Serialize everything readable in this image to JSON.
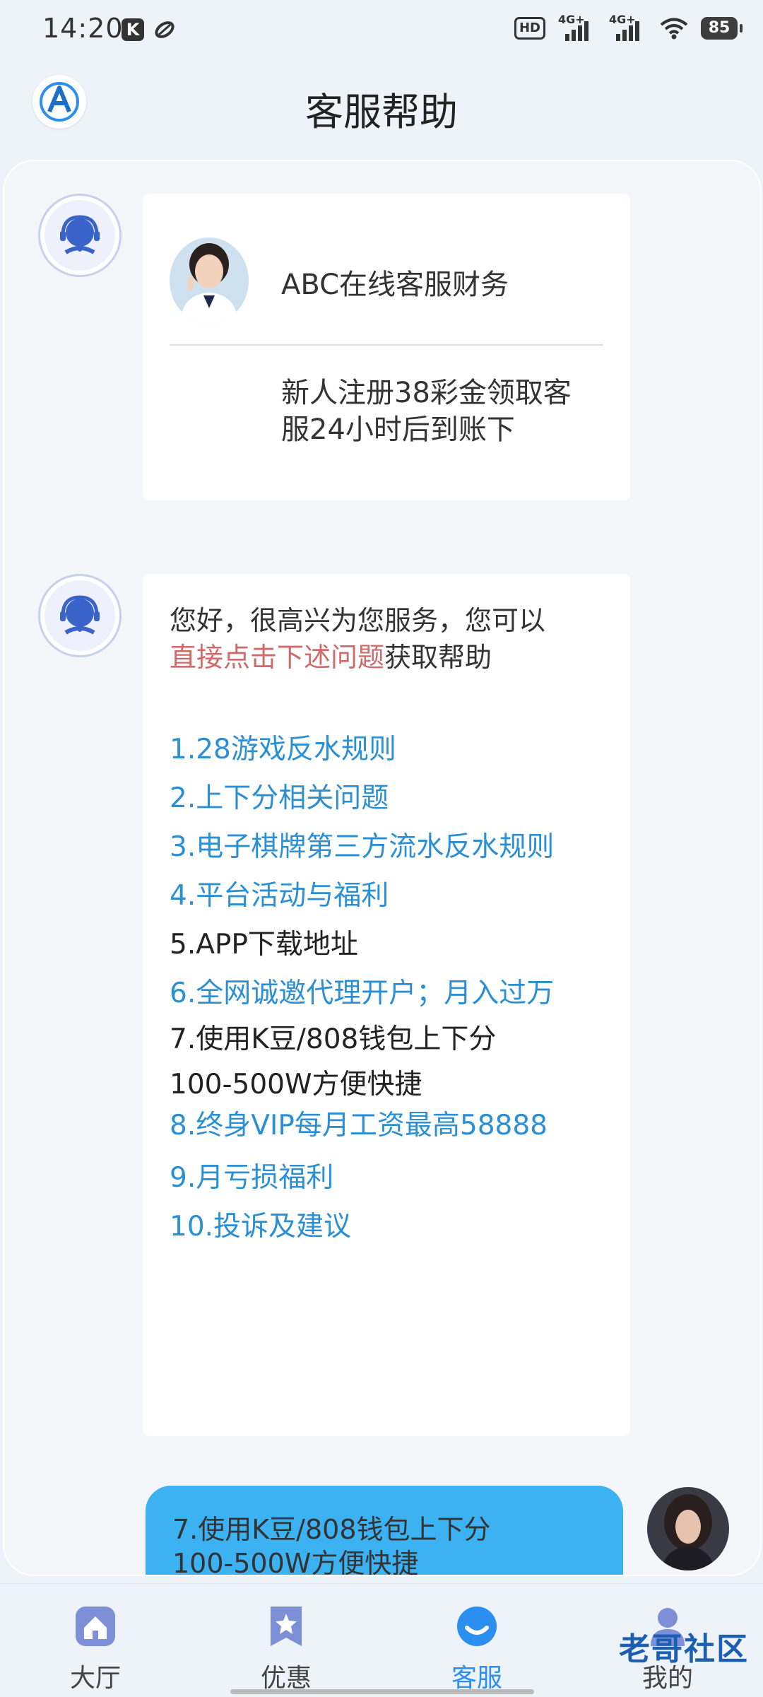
{
  "status_bar": {
    "time": "14:20",
    "k_badge": "K",
    "hd_label": "HD",
    "signal_1": "4G+",
    "signal_2": "4G+",
    "battery": "85"
  },
  "header": {
    "title": "客服帮助",
    "logo_icon": "app-logo-icon"
  },
  "agent_card": {
    "name": "ABC在线客服财务",
    "notice_line_1": "新人注册38彩金领取客",
    "notice_line_2": "服24小时后到账下"
  },
  "welcome": {
    "greeting_line_1": "您好，很高兴为您服务，您可以",
    "greeting_highlight": "直接点击下述问题",
    "greeting_suffix": "获取帮助",
    "highlight_color": "#d06a6a"
  },
  "questions": [
    {
      "text": "1.28游戏反水规则",
      "color": "blue"
    },
    {
      "text": "2.上下分相关问题",
      "color": "blue"
    },
    {
      "text": "3.电子棋牌第三方流水反水规则",
      "color": "blue"
    },
    {
      "text": "4.平台活动与福利",
      "color": "blue"
    },
    {
      "text": "5.APP下载地址",
      "color": "black"
    },
    {
      "text": "6.全网诚邀代理开户；月入过万",
      "color": "blue"
    },
    {
      "text_line_1": "7.使用K豆/808钱包上下分",
      "text_line_2": "100-500W方便快捷",
      "color": "black"
    },
    {
      "text": "8.终身VIP每月工资最高58888",
      "color": "blue"
    },
    {
      "text": "9.月亏损福利",
      "color": "blue"
    },
    {
      "text": "10.投诉及建议",
      "color": "blue"
    }
  ],
  "user_message": {
    "line_1": "7.使用K豆/808钱包上下分",
    "line_2": "100-500W方便快捷",
    "bubble_color": "#3cb2f3"
  },
  "bottom_nav": {
    "items": [
      {
        "label": "大厅",
        "icon": "home-icon"
      },
      {
        "label": "优惠",
        "icon": "star-bookmark-icon"
      },
      {
        "label": "客服",
        "icon": "customer-service-icon",
        "active": true
      },
      {
        "label": "我的",
        "icon": "user-icon"
      }
    ],
    "active_color": "#2a8ff0",
    "watermark": "老哥社区"
  }
}
